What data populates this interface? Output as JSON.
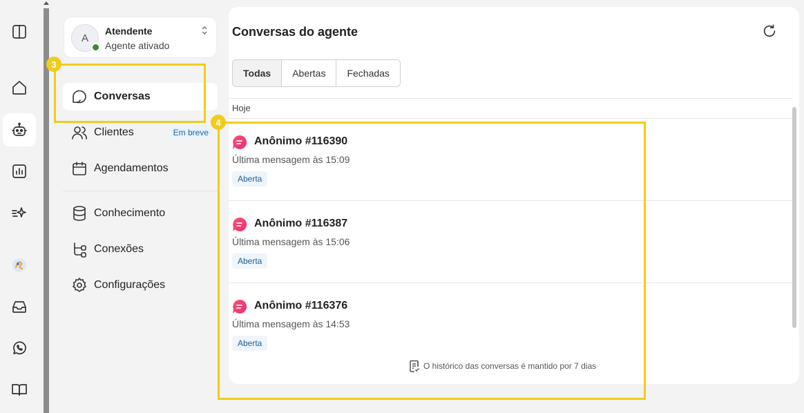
{
  "agent": {
    "avatar_initial": "A",
    "name": "Atendente",
    "status": "Agente ativado"
  },
  "nav": {
    "conversas": "Conversas",
    "clientes": "Clientes",
    "clientes_badge": "Em breve",
    "agendamentos": "Agendamentos",
    "conhecimento": "Conhecimento",
    "conexoes": "Conexões",
    "configuracoes": "Configurações"
  },
  "annotations": {
    "nav_marker": "3",
    "list_marker": "4",
    "color": "#f2cb1d"
  },
  "main": {
    "title": "Conversas do agente",
    "tabs": [
      "Todas",
      "Abertas",
      "Fechadas"
    ],
    "active_tab": "Todas",
    "date_group": "Hoje",
    "conversations": [
      {
        "name": "Anônimo #116390",
        "last_message": "Última mensagem às 15:09",
        "status": "Aberta"
      },
      {
        "name": "Anônimo #116387",
        "last_message": "Última mensagem às 15:06",
        "status": "Aberta"
      },
      {
        "name": "Anônimo #116376",
        "last_message": "Última mensagem às 14:53",
        "status": "Aberta"
      }
    ],
    "history_note": "O histórico das conversas é mantido por 7 dias"
  },
  "colors": {
    "status_active": "#3a8c2f",
    "status_badge_text": "#1a5f9c",
    "chat_icon_gradient": [
      "#ff4f6d",
      "#e8307c"
    ]
  },
  "rail_icons": [
    "sidebar-toggle-icon",
    "home-icon",
    "robot-icon",
    "chart-icon",
    "sparkle-icon",
    "workspace-logo-icon",
    "inbox-icon",
    "whatsapp-icon",
    "book-icon"
  ]
}
